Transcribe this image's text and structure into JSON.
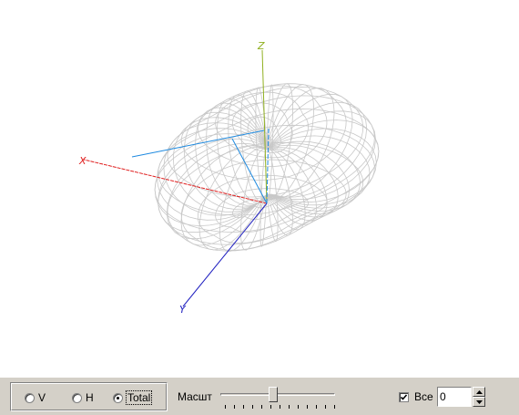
{
  "viewport": {
    "axes": {
      "z_label": "Z",
      "x_label": "X",
      "y_label": "Y"
    },
    "colors": {
      "mesh": "#c8c8c8",
      "x_axis": "#e02020",
      "y_axis": "#2020c0",
      "z_axis": "#90b020",
      "markers": "#1e8ae0"
    }
  },
  "toolbar": {
    "polarization": {
      "options": [
        "V",
        "H",
        "Total"
      ],
      "selected": "Total"
    },
    "scale_label": "Масшт",
    "scale_slider_fraction": 0.5,
    "all_label": "Все",
    "all_checked": true,
    "value": "0"
  }
}
